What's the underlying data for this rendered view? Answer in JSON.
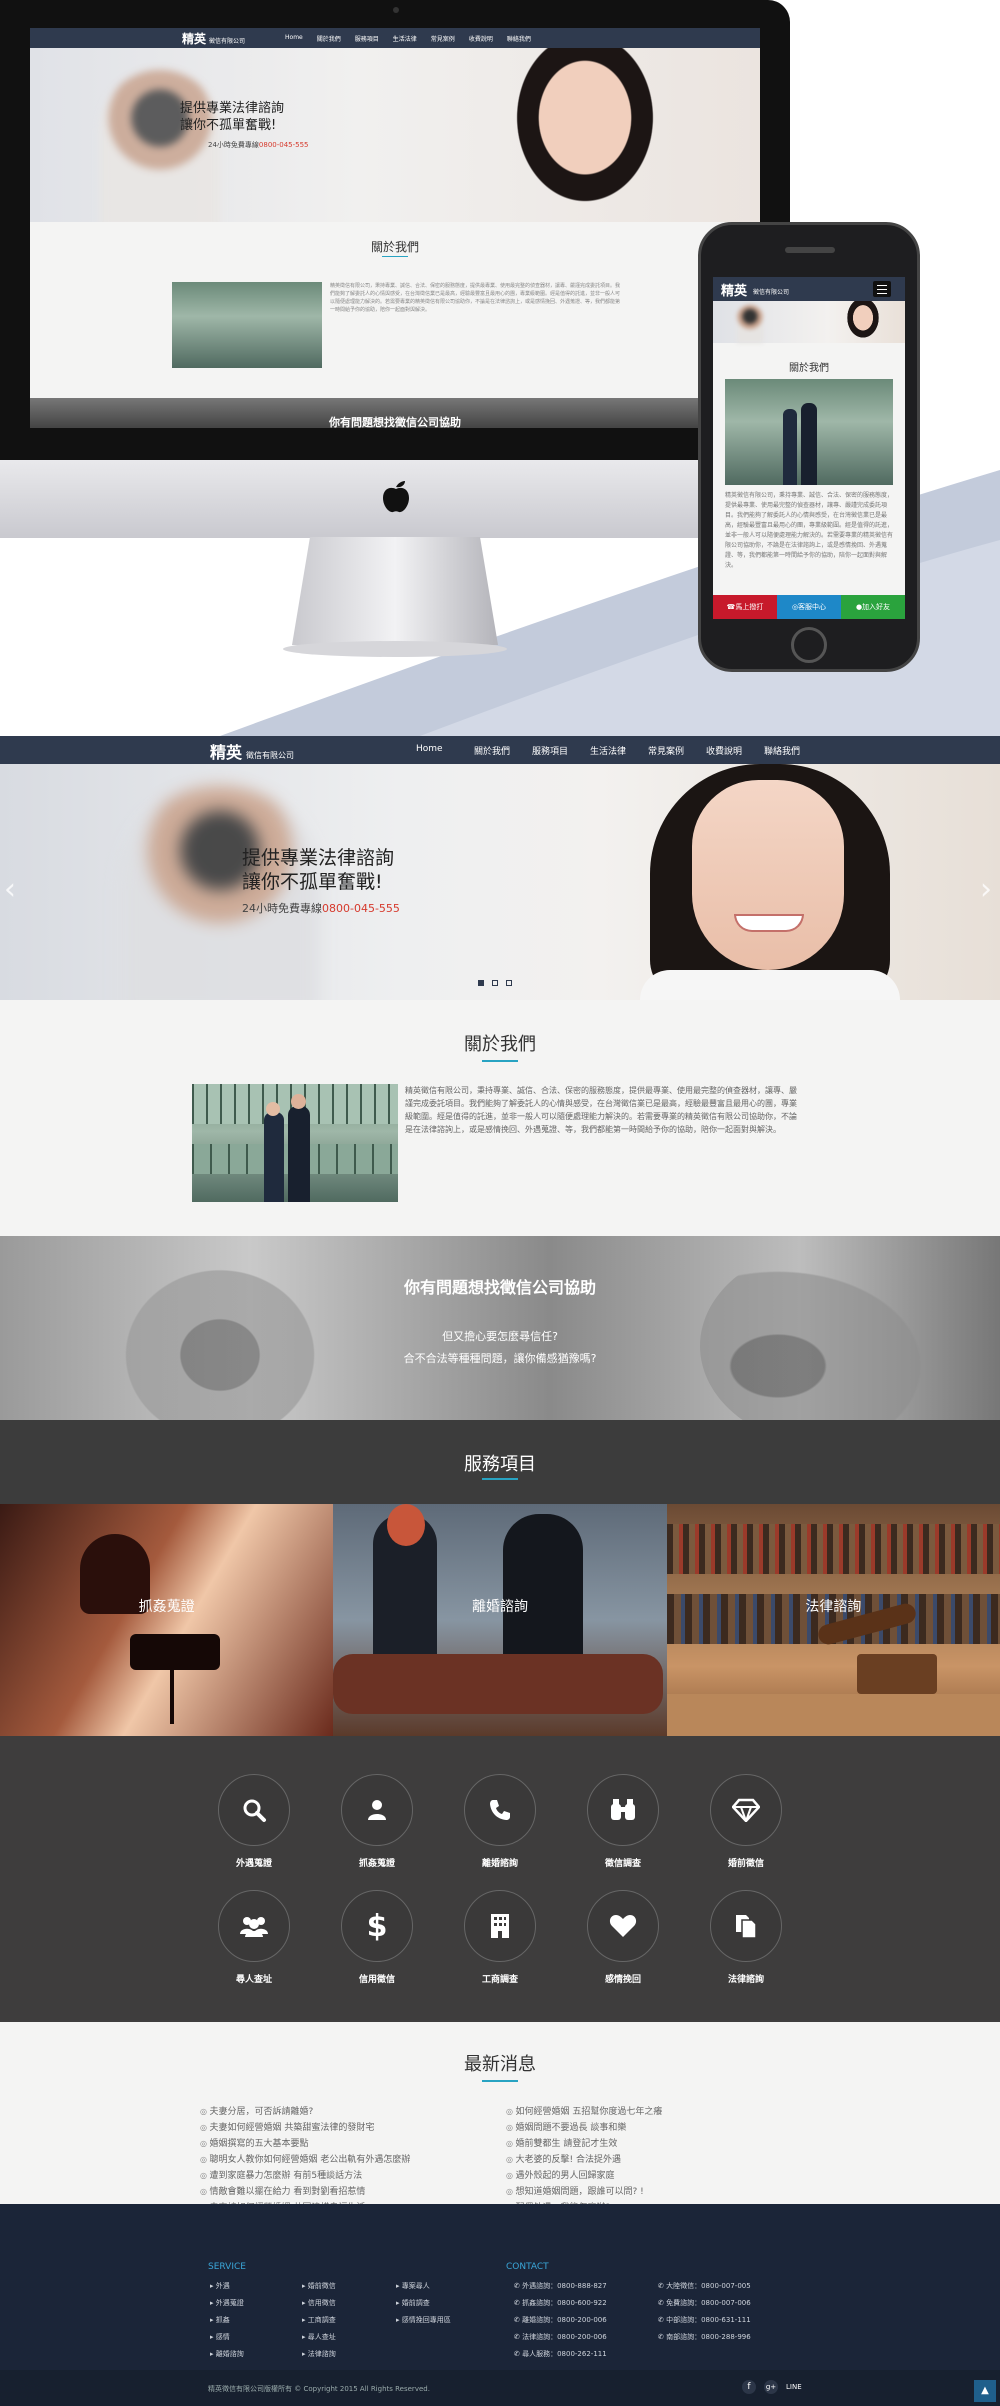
{
  "brand": {
    "logo": "精英",
    "logo_sub": "徵信有限公司"
  },
  "nav": [
    "Home",
    "關於我們",
    "服務項目",
    "生活法律",
    "常見案例",
    "收費說明",
    "聯絡我們"
  ],
  "hero": {
    "line1": "提供專業法律諮詢",
    "line2": "讓你不孤單奮戰!",
    "phone_prefix": "24小時免費專線",
    "phone": "0800-045-555"
  },
  "about": {
    "title": "關於我們",
    "text": "精英徵信有限公司，秉持專業、誠信、合法、保密的服務態度，提供最專業、使用最完整的偵查器材，讓專、嚴謹完成委託項目。我們能夠了解委託人的心情與感受，在台灣徵信業已是最高，經驗最豐富且最用心的團，專業級範圍。經是值得的託進，並非一般人可以隨便處理能力解決的。若需要專業的精英徵信有限公司協助你，不論是在法律諮詢上，或是感情挽回、外遇蒐證、等，我們都能第一時間給予你的協助，陪你一起面對與解決。"
  },
  "help": {
    "title": "你有問題想找徵信公司協助",
    "line1": "但又擔心要怎麼尋信任?",
    "line2": "合不合法等種種問題，讓你備感猶豫嗎?"
  },
  "services": {
    "title": "服務項目",
    "cards": [
      "抓姦蒐證",
      "離婚諮詢",
      "法律諮詢"
    ]
  },
  "icons": [
    {
      "name": "search",
      "label": "外遇蒐證"
    },
    {
      "name": "person",
      "label": "抓姦蒐證"
    },
    {
      "name": "phone",
      "label": "離婚諮詢"
    },
    {
      "name": "binoculars",
      "label": "徵信調查"
    },
    {
      "name": "diamond",
      "label": "婚前徵信"
    },
    {
      "name": "group",
      "label": "尋人查址"
    },
    {
      "name": "dollar",
      "label": "信用徵信"
    },
    {
      "name": "building",
      "label": "工商調查"
    },
    {
      "name": "heart",
      "label": "感情挽回"
    },
    {
      "name": "documents",
      "label": "法律諮詢"
    }
  ],
  "news": {
    "title": "最新消息",
    "left": [
      "夫妻分居，可否訴請離婚?",
      "夫妻如何經營婚姻 共築甜蜜法律的發財宅",
      "婚姻撰寫的五大基本要點",
      "聰明女人教你如何經營婚姻 老公出軌有外遇怎麼辦",
      "遭到家庭暴力怎麼辦 有前5種談話方法",
      "情敵會難以擺在給力 看到對劉看招惹情",
      "夫妻該如何經營婚姻 共同建構幸福生活"
    ],
    "right": [
      "如何經營婚姻 五招幫你度過七年之癢",
      "婚姻問題不要過長 談事和樂",
      "婚前雙都生 請登記才生效",
      "大老婆的反擊! 合法捉外遇",
      "遇外殼起的男人回歸家庭",
      "想知道婚姻問題，跟誰可以問? !",
      "配偶外遇，我能怎麼辦?"
    ]
  },
  "footer": {
    "service_title": "SERVICE",
    "service_cols": [
      [
        "外遇",
        "外遇蒐證",
        "抓姦",
        "感情",
        "離婚諮詢"
      ],
      [
        "婚前徵信",
        "信用徵信",
        "工商調查",
        "尋人查址",
        "法律諮詢"
      ],
      [
        "專案尋人",
        "婚前調查",
        "感情挽回專用區"
      ]
    ],
    "contact_title": "CONTACT",
    "contact_col1": [
      "外遇諮詢：0800-888-827",
      "抓姦諮詢：0800-600-922",
      "離婚諮詢：0800-200-006",
      "法律諮詢：0800-200-006",
      "尋人服務：0800-262-111"
    ],
    "contact_col2": [
      "大陸徵信：0800-007-005",
      "免費諮詢：0800-007-006",
      "中部諮詢：0800-631-111",
      "南部諮詢：0800-288-996"
    ],
    "copyright": "精英徵信有限公司版權所有 © Copyright 2015 All Rights Reserved.",
    "line_label": "LINE"
  },
  "phone_mock": {
    "about_title": "關於我們",
    "buttons": [
      "馬上撥打",
      "客服中心",
      "加入好友"
    ]
  }
}
